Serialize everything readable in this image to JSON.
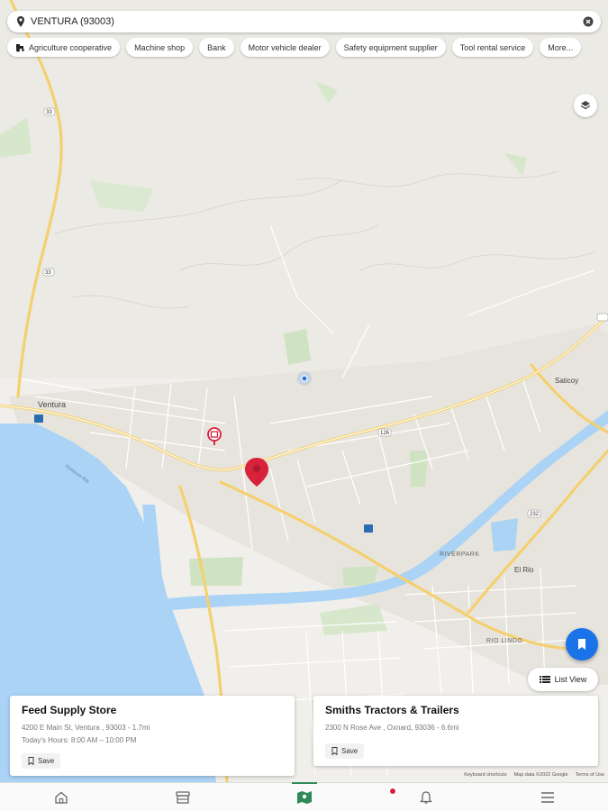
{
  "search": {
    "location": "VENTURA (93003)"
  },
  "chips": [
    "Agriculture cooperative",
    "Machine shop",
    "Bank",
    "Motor vehicle dealer",
    "Safety equipment supplier",
    "Tool rental service",
    "More..."
  ],
  "map_labels": {
    "ventura": "Ventura",
    "saticoy": "Saticoy",
    "el_rio": "El Rio",
    "riverpark": "RIVERPARK",
    "rio_lindo": "RIO LINDO",
    "flintstone_bay": "Flintstone Bay",
    "hwy_126": "126",
    "hwy_101": "101",
    "hwy_33": "33",
    "hwy_232": "232"
  },
  "list_view_label": "List View",
  "cards": [
    {
      "name": "Feed Supply Store",
      "address": "4200 E Main St, Ventura , 93003 - 1.7mi",
      "hours": "Today's Hours: 8:00 AM – 10:00 PM",
      "save_label": "Save"
    },
    {
      "name": "Smiths Tractors & Trailers",
      "address": "2300 N Rose Ave , Oxnard, 93036 - 6.6mi",
      "save_label": "Save"
    }
  ],
  "attribution": [
    "Keyboard shortcuts",
    "Map data ©2022 Google",
    "Terms of Use"
  ],
  "tabs": [
    {
      "icon": "home-icon"
    },
    {
      "icon": "store-icon"
    },
    {
      "icon": "map-icon",
      "active": true
    },
    {
      "icon": "bell-icon"
    },
    {
      "icon": "menu-icon"
    }
  ],
  "colors": {
    "water": "#aad3f5",
    "road": "#f4d06f",
    "accent": "#1a73e8",
    "pin": "#d8213b",
    "active_tab": "#2e8b57"
  }
}
